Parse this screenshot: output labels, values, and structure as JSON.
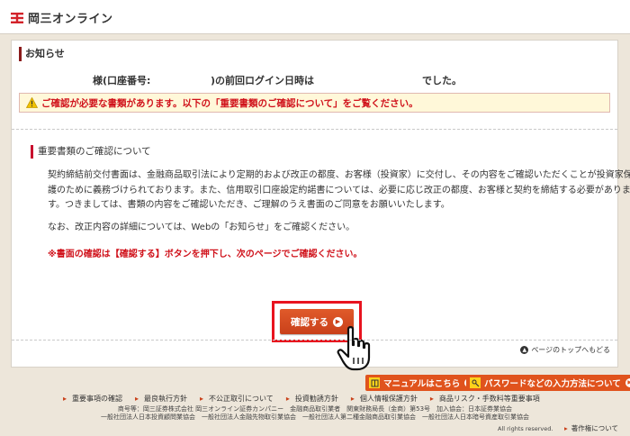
{
  "header": {
    "logo_text": "岡三オンライン"
  },
  "notice": {
    "title": "お知らせ",
    "login_name_suffix": "様(口座番号:",
    "login_time_label": ")の前回ログイン日時は",
    "login_end": "でした。",
    "warning": "ご確認が必要な書類があります。以下の「重要書類のご確認について」をご覧ください。"
  },
  "doc": {
    "title": "重要書類のご確認について",
    "para1": [
      "契約締結前交付書面は、金融商品取引法により定期的および改正の都度、お客様（投資家）に交付し、その内容をご確認いただくことが投資家保",
      "護のために義務づけられております。また、信用取引口座設定約諾書については、必要に応じ改正の都度、お客様と契約を締結する必要がありま",
      "す。つきましては、書類の内容をご確認いただき、ご理解のうえ書面のご同意をお願いいたします。"
    ],
    "para2": "なお、改正内容の詳細については、Webの「お知らせ」をご確認ください。",
    "red_note": "※書面の確認は【確認する】ボタンを押下し、次のページでご確認ください。",
    "confirm_label": "確認する",
    "page_top": "ページのトップへもどる"
  },
  "footer": {
    "manual_btn": "マニュアルはこちら",
    "password_btn": "パスワードなどの入力方法について",
    "links": [
      "重要事項の確認",
      "最良執行方針",
      "不公正取引について",
      "投資勧誘方針",
      "個人情報保護方針",
      "商品リスク・手数料等重要事項"
    ],
    "company_line1": "商号等：岡三証券株式会社 岡三オンライン証券カンパニー　金融商品取引業者　関東財務局長（金商）第53号　加入協会：日本証券業協会",
    "company_line2": "一般社団法人日本投資顧問業協会　一般社団法人金融先物取引業協会　一般社団法人第二種金融商品取引業協会　一般社団法人日本暗号資産取引業協会",
    "copyright": "All rights reserved.",
    "copyright_link": "著作権について"
  },
  "colors": {
    "accent": "#e0531d",
    "warning_red": "#d0121b",
    "highlight_border": "#e8131f"
  },
  "icons": [
    "okasan-logo-icon",
    "warning-triangle-icon",
    "arrow-circle-icon",
    "hand-cursor-icon",
    "up-arrow-icon",
    "book-icon",
    "key-icon"
  ]
}
